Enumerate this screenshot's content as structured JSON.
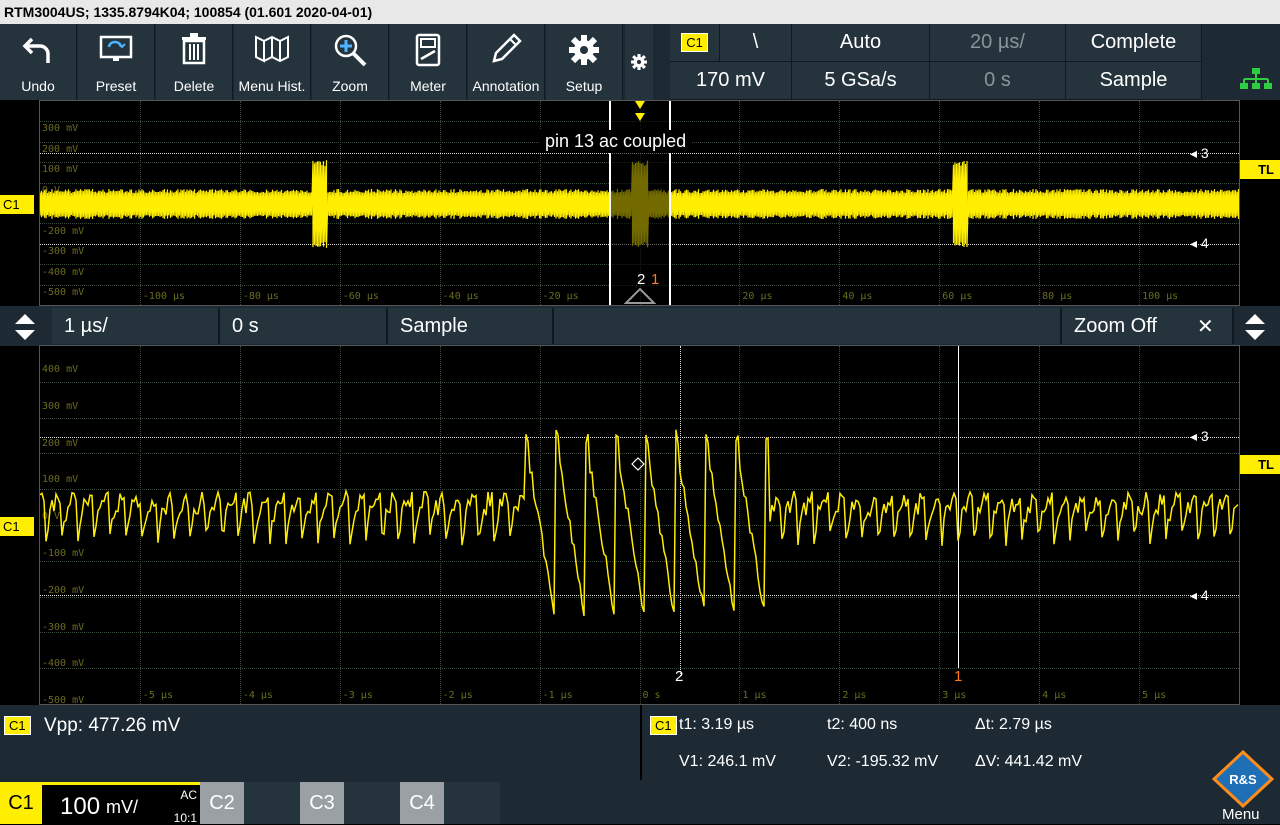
{
  "title": "RTM3004US; 1335.8794K04; 100854 (01.601 2020-04-01)",
  "toolbar": {
    "buttons": [
      {
        "label": "Undo",
        "icon": "undo-icon"
      },
      {
        "label": "Preset",
        "icon": "preset-icon"
      },
      {
        "label": "Delete",
        "icon": "trash-icon"
      },
      {
        "label": "Menu Hist.",
        "icon": "menu-history-icon"
      },
      {
        "label": "Zoom",
        "icon": "zoom-icon"
      },
      {
        "label": "Meter",
        "icon": "meter-icon"
      },
      {
        "label": "Annotation",
        "icon": "pencil-icon"
      },
      {
        "label": "Setup",
        "icon": "gear-icon"
      }
    ]
  },
  "trigger": {
    "source": "C1",
    "slope": "\\",
    "mode": "Auto",
    "level": "170 mV",
    "sample_rate": "5 GSa/s",
    "timebase": "20 µs/",
    "position": "0 s",
    "state": "Complete",
    "acq": "Sample"
  },
  "overview": {
    "annotation": "pin 13 ac coupled",
    "ylabels": [
      "300 mV",
      "200 mV",
      "100 mV",
      "0 V",
      "-100 mV",
      "-200 mV",
      "-300 mV",
      "-400 mV",
      "-500 mV"
    ],
    "xlabels": [
      "-100 µs",
      "-80 µs",
      "-60 µs",
      "-40 µs",
      "-20 µs",
      "20 µs",
      "40 µs",
      "60 µs",
      "80 µs",
      "100 µs"
    ],
    "ch_marker": "C1",
    "tl_marker": "TL",
    "cursor3": "3",
    "cursor4": "4",
    "cursor1": "1",
    "cursor2": "2"
  },
  "zoombar": {
    "timebase": "1 µs/",
    "position": "0 s",
    "acq": "Sample",
    "zoom_off": "Zoom Off",
    "close": "✕"
  },
  "zoom": {
    "ylabels": [
      "400 mV",
      "300 mV",
      "200 mV",
      "100 mV",
      "0 V",
      "-100 mV",
      "-200 mV",
      "-300 mV",
      "-400 mV",
      "-500 mV"
    ],
    "xlabels": [
      "-5 µs",
      "-4 µs",
      "-3 µs",
      "-2 µs",
      "-1 µs",
      "0 s",
      "1 µs",
      "2 µs",
      "3 µs",
      "4 µs",
      "5 µs"
    ],
    "ch_marker": "C1",
    "tl_marker": "TL",
    "cursor3": "3",
    "cursor4": "4",
    "cursor1": "1",
    "cursor2": "2"
  },
  "measurements": {
    "left_badge": "C1",
    "vpp": "Vpp: 477.26 mV",
    "cursor_badge": "C1",
    "t1": "t1: 3.19 µs",
    "t2": "t2: 400 ns",
    "dt": "Δt: 2.79 µs",
    "v1": "V1: 246.1 mV",
    "v2": "V2: -195.32 mV",
    "dv": "ΔV: 441.42 mV"
  },
  "channels": {
    "c1_label": "C1",
    "c1_scale": "100",
    "c1_unit": "mV/",
    "c1_coupling": "AC",
    "c1_probe": "10:1",
    "c2": "C2",
    "c3": "C3",
    "c4": "C4",
    "menu": "Menu",
    "logo": "R&S"
  },
  "colors": {
    "trace": "#ffee00",
    "accent": "#ffee00",
    "cursor1": "#ff7a1a"
  }
}
